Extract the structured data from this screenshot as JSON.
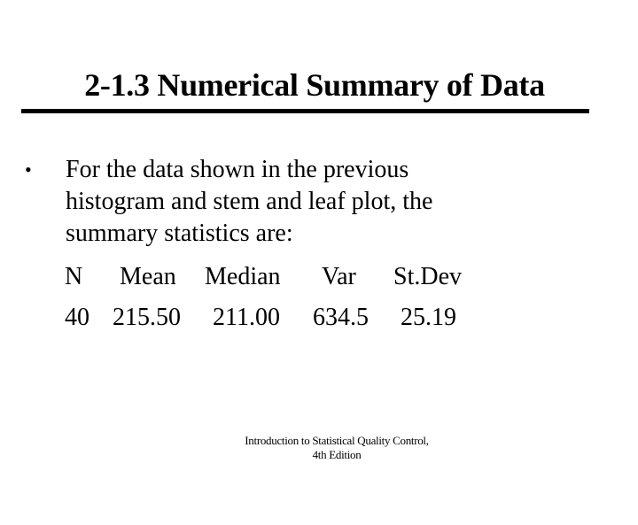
{
  "slide": {
    "title": "2-1.3 Numerical Summary of Data",
    "bullet": {
      "icon": "•",
      "lines": [
        "For the data shown in the previous",
        "histogram and stem and leaf plot, the",
        "summary statistics are:"
      ]
    },
    "stats_table": {
      "headers": [
        "N",
        "Mean",
        "Median",
        "Var",
        "St.Dev"
      ],
      "values": [
        "40",
        "215.50",
        "211.00",
        "634.5",
        "25.19"
      ]
    },
    "footer": {
      "line1": "Introduction to Statistical Quality Control,",
      "line2": "4th Edition"
    }
  }
}
